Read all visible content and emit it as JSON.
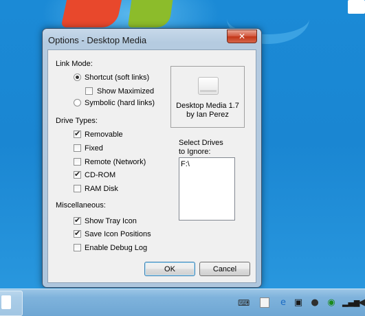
{
  "window": {
    "title": "Options - Desktop Media",
    "close_glyph": "✕"
  },
  "link_mode": {
    "heading": "Link Mode:",
    "shortcut_label": "Shortcut (soft links)",
    "shortcut_selected": true,
    "show_maximized_label": "Show Maximized",
    "show_maximized_checked": false,
    "symbolic_label": "Symbolic (hard links)",
    "symbolic_selected": false
  },
  "about": {
    "icon": "drive-icon",
    "line1": "Desktop Media 1.7",
    "line2": "by Ian Perez"
  },
  "drive_types": {
    "heading": "Drive Types:",
    "items": [
      {
        "label": "Removable",
        "checked": true
      },
      {
        "label": "Fixed",
        "checked": false
      },
      {
        "label": "Remote (Network)",
        "checked": false
      },
      {
        "label": "CD-ROM",
        "checked": true
      },
      {
        "label": "RAM Disk",
        "checked": false
      }
    ]
  },
  "ignore": {
    "label_line1": "Select Drives",
    "label_line2": "to Ignore:",
    "drives": [
      "F:\\"
    ]
  },
  "misc": {
    "heading": "Miscellaneous:",
    "items": [
      {
        "label": "Show Tray Icon",
        "checked": true
      },
      {
        "label": "Save Icon Positions",
        "checked": true
      },
      {
        "label": "Enable Debug Log",
        "checked": false
      }
    ]
  },
  "buttons": {
    "ok": "OK",
    "cancel": "Cancel"
  },
  "taskbar": {
    "tray_icons": [
      "keyboard-icon",
      "document-icon",
      "ie-update-icon",
      "network-drive-icon",
      "chat-icon",
      "network-status-icon",
      "signal-icon",
      "volume-icon"
    ]
  }
}
